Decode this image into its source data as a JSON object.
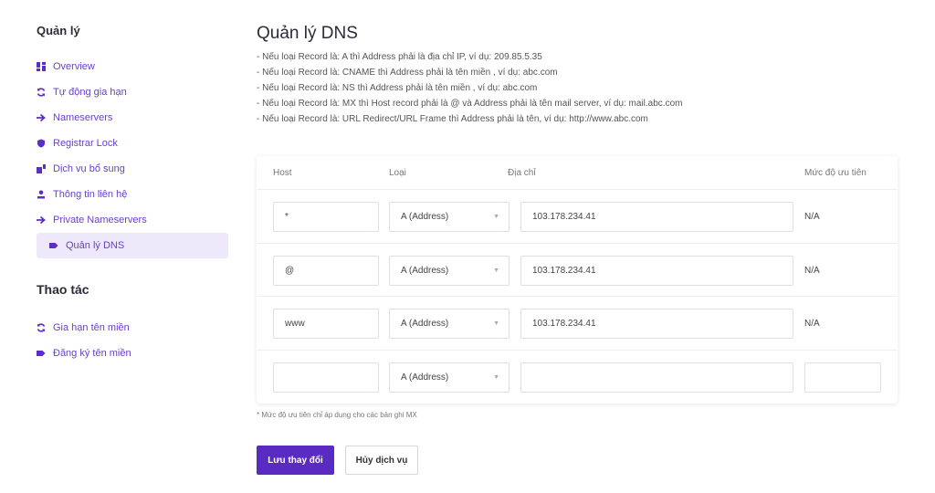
{
  "sidebar": {
    "heading_manage": "Quản lý",
    "items": [
      {
        "label": "Overview",
        "icon": "grid-icon"
      },
      {
        "label": "Tự động gia hạn",
        "icon": "refresh-icon"
      },
      {
        "label": "Nameservers",
        "icon": "arrow-right-icon"
      },
      {
        "label": "Registrar Lock",
        "icon": "shield-icon"
      },
      {
        "label": "Dịch vụ bổ sung",
        "icon": "puzzle-icon"
      },
      {
        "label": "Thông tin liên hệ",
        "icon": "user-icon"
      },
      {
        "label": "Private Nameservers",
        "icon": "arrow-right-icon"
      },
      {
        "label": "Quản lý DNS",
        "icon": "tag-icon",
        "active": true
      }
    ],
    "heading_actions": "Thao tác",
    "actions": [
      {
        "label": "Gia hạn tên miền",
        "icon": "refresh-icon"
      },
      {
        "label": "Đăng ký tên miền",
        "icon": "tag-icon"
      }
    ]
  },
  "main": {
    "title": "Quản lý DNS",
    "notes": [
      "- Nếu loại Record là: A thì Address phải là địa chỉ IP, ví dụ: 209.85.5.35",
      "- Nếu loại Record là: CNAME thì Address phải là tên miền , ví dụ: abc.com",
      "- Nếu loại Record là: NS thì Address phải là tên miền , ví dụ: abc.com",
      "- Nếu loại Record là: MX thì Host record phải là @ và Address phải là tên mail server, ví dụ: mail.abc.com",
      "- Nếu loại Record là: URL Redirect/URL Frame thì Address phải là tên, ví dụ: http://www.abc.com"
    ],
    "table": {
      "headers": {
        "host": "Host",
        "type": "Loại",
        "address": "Địa chỉ",
        "priority": "Mức độ ưu tiên"
      },
      "rows": [
        {
          "host": "*",
          "type": "A (Address)",
          "address": "103.178.234.41",
          "priority": "N/A"
        },
        {
          "host": "@",
          "type": "A (Address)",
          "address": "103.178.234.41",
          "priority": "N/A"
        },
        {
          "host": "www",
          "type": "A (Address)",
          "address": "103.178.234.41",
          "priority": "N/A"
        },
        {
          "host": "",
          "type": "A (Address)",
          "address": "",
          "priority": ""
        }
      ]
    },
    "footnote": "* Mức độ ưu tiên chỉ áp dụng cho các bản ghi MX",
    "save_label": "Lưu thay đổi",
    "cancel_label": "Hủy dịch vụ"
  },
  "colors": {
    "accent": "#5a2bc2",
    "active_bg": "#ede9fb"
  }
}
